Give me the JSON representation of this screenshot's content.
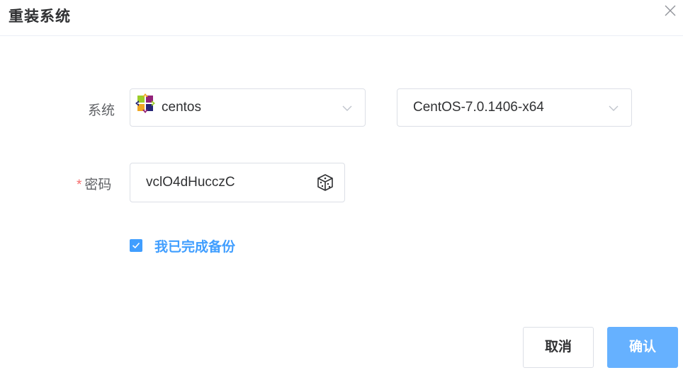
{
  "dialog": {
    "title": "重装系统",
    "close_icon": "close-icon"
  },
  "form": {
    "system_label": "系统",
    "os_select": {
      "value": "centos",
      "icon": "centos-logo-icon"
    },
    "version_select": {
      "value": "CentOS-7.0.1406-x64"
    },
    "password_required_mark": "*",
    "password_label": "密码",
    "password": {
      "value": "vclO4dHucczC",
      "icon": "dice-icon"
    },
    "backup_checkbox": {
      "checked": true,
      "label": "我已完成备份"
    }
  },
  "footer": {
    "cancel_label": "取消",
    "confirm_label": "确认"
  },
  "colors": {
    "primary": "#409eff",
    "primary_light": "#66b1ff",
    "required": "#f56c6c",
    "border": "#dcdfe6"
  }
}
